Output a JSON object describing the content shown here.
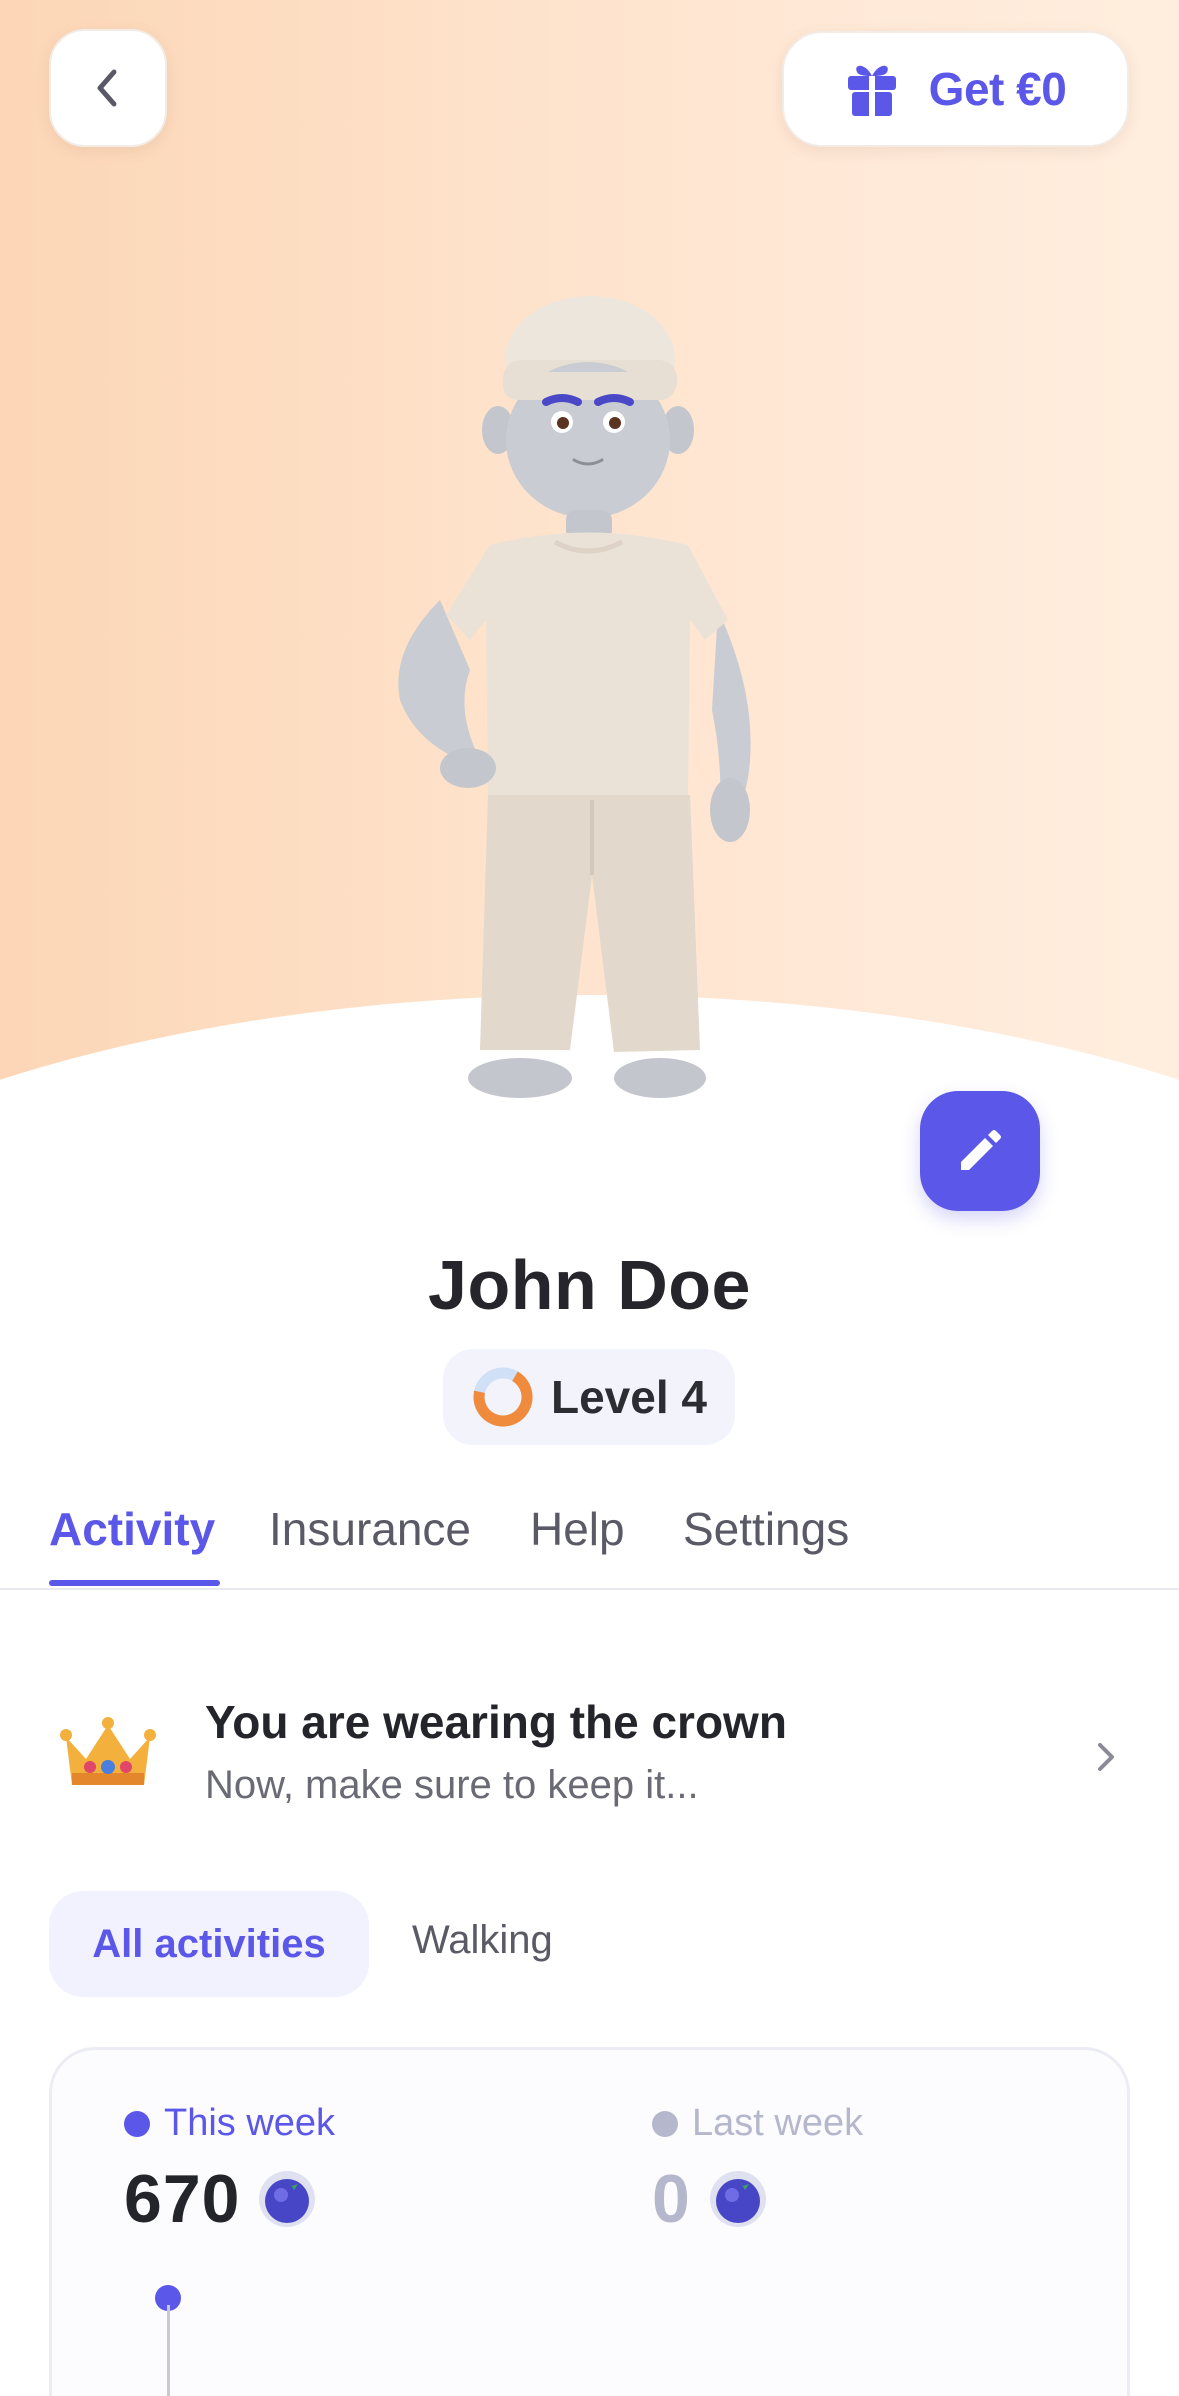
{
  "header": {
    "get_label": "Get €0"
  },
  "profile": {
    "name": "John Doe",
    "level_label": "Level 4",
    "level_progress": 0.7
  },
  "tabs": [
    {
      "label": "Activity",
      "active": true
    },
    {
      "label": "Insurance",
      "active": false
    },
    {
      "label": "Help",
      "active": false
    },
    {
      "label": "Settings",
      "active": false
    }
  ],
  "crown_card": {
    "title": "You are wearing the crown",
    "subtitle": "Now, make sure to keep it..."
  },
  "filters": {
    "all_label": "All activities",
    "walking_label": "Walking"
  },
  "stats": {
    "this_week_label": "This week",
    "this_week_value": "670",
    "last_week_label": "Last week",
    "last_week_value": "0"
  },
  "colors": {
    "accent": "#5b57e8",
    "hero_gradient_start": "#fcd6b6",
    "hero_gradient_end": "#ffeede",
    "level_ring": "#f08a3c",
    "muted": "#b5b7cc"
  },
  "icons": {
    "back": "chevron-left-icon",
    "gift": "gift-icon",
    "edit": "pencil-icon",
    "crown": "crown-icon",
    "chevron": "chevron-right-icon",
    "coin": "blueberry-coin-icon"
  }
}
